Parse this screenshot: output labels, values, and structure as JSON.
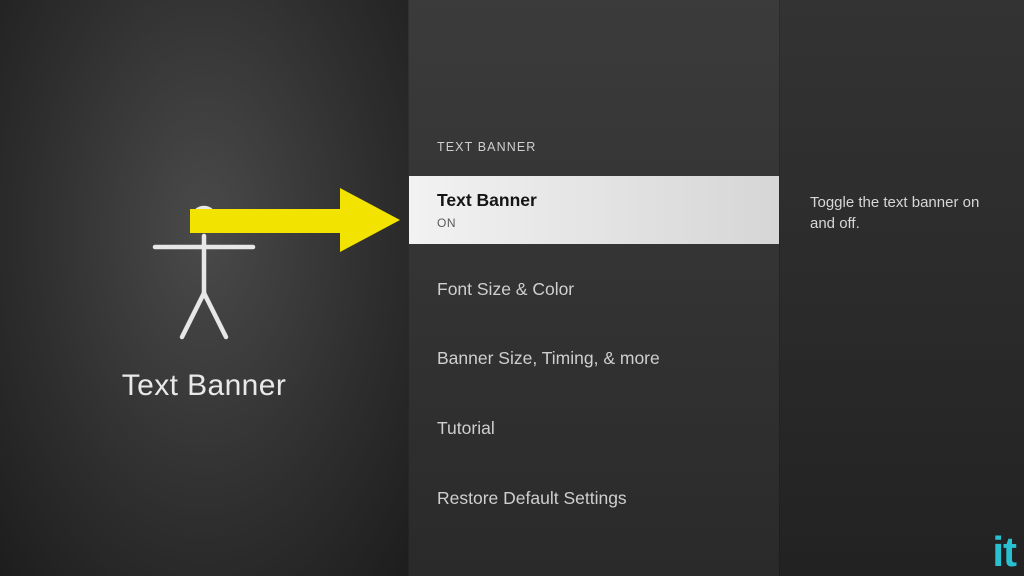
{
  "left": {
    "title": "Text Banner"
  },
  "menu": {
    "header": "TEXT BANNER",
    "items": [
      {
        "title": "Text Banner",
        "value": "ON"
      },
      {
        "title": "Font Size & Color"
      },
      {
        "title": "Banner Size, Timing, & more"
      },
      {
        "title": "Tutorial"
      },
      {
        "title": "Restore Default Settings"
      }
    ]
  },
  "description": "Toggle the text banner on and off.",
  "watermark": "it"
}
